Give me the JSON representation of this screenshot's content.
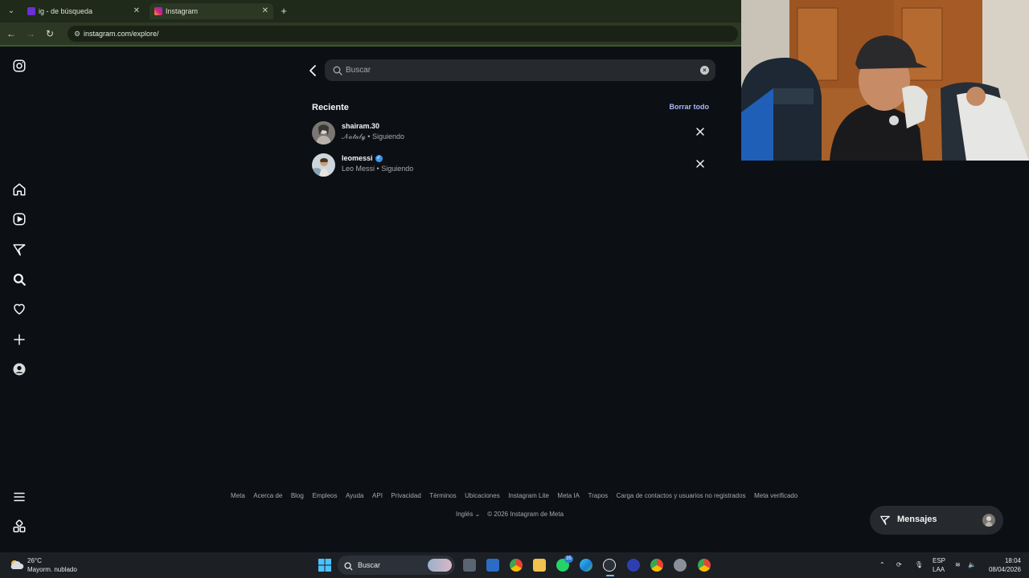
{
  "browser": {
    "tabs": [
      {
        "title": "ig - de búsqueda",
        "favicon": "yahoo-icon",
        "active": false
      },
      {
        "title": "Instagram",
        "favicon": "instagram-icon",
        "active": true
      }
    ],
    "url": "instagram.com/explore/"
  },
  "search": {
    "placeholder": "Buscar",
    "value": ""
  },
  "recent": {
    "title": "Reciente",
    "clear_all": "Borrar todo",
    "items": [
      {
        "username": "shairam.30",
        "full_name": "𝒩𝒶𝓉𝒶𝓁𝓎",
        "status": "Siguiendo",
        "verified": false
      },
      {
        "username": "leomessi",
        "full_name": "Leo Messi",
        "status": "Siguiendo",
        "verified": true
      }
    ]
  },
  "footer": {
    "links": [
      "Meta",
      "Acerca de",
      "Blog",
      "Empleos",
      "Ayuda",
      "API",
      "Privacidad",
      "Términos",
      "Ubicaciones",
      "Instagram Lite",
      "Meta IA",
      "Trapos",
      "Carga de contactos y usuarios no registrados",
      "Meta verificado"
    ],
    "language": "Inglés",
    "copyright": "© 2026 Instagram de Meta"
  },
  "messages": {
    "label": "Mensajes"
  },
  "taskbar": {
    "temperature": "26°C",
    "weather": "Mayorm. nublado",
    "search_label": "Buscar",
    "whatsapp_badge": "35",
    "language": "ESP",
    "keyboard": "LAA",
    "time": "18:04",
    "date": "08/04/2026"
  },
  "colors": {
    "background": "#0c1014",
    "accent_link": "#a9b8ff",
    "verified": "#3897f0",
    "browser_frame": "#2c3824"
  }
}
